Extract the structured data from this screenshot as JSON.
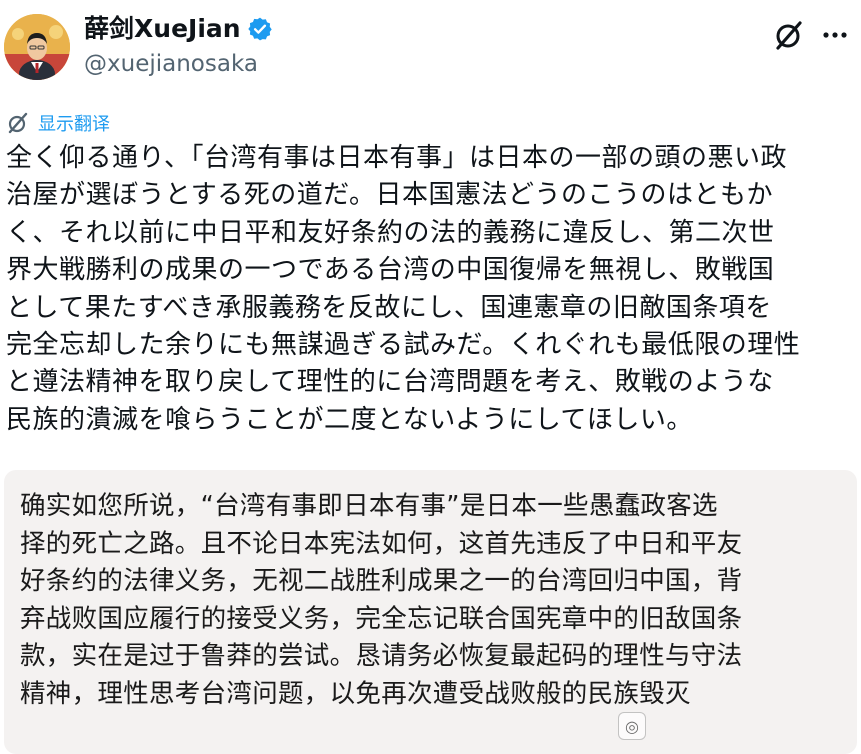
{
  "post": {
    "author": {
      "display_name": "薛剑XueJian",
      "handle": "@xuejianosaka",
      "verified": true,
      "avatar": "avatar-portrait"
    },
    "actions": {
      "grok_icon": "grok-icon",
      "more_icon": "more-icon",
      "more_label": "···"
    },
    "translate_label": "显示翻译",
    "text_lines": [
      "全く仰る通り、「台湾有事は日本有事」は日本の一部の頭の悪い政",
      "治屋が選ぼうとする死の道だ。日本国憲法どうのこうのはともか",
      "く、それ以前に中日平和友好条約の法的義務に違反し、第二次世",
      "界大戦勝利の成果の一つである台湾の中国復帰を無視し、敗戦国",
      "として果たすべき承服義務を反故にし、国連憲章の旧敵国条項を",
      "完全忘却した余りにも無謀過ぎる試みだ。くれぐれも最低限の理性",
      "と遵法精神を取り戻して理性的に台湾問題を考え、敗戦のような",
      "民族的潰滅を喰らうことが二度とないようにしてほしい。"
    ]
  },
  "translation": {
    "lines": [
      "确实如您所说，“台湾有事即日本有事”是日本一些愚蠢政客选",
      "择的死亡之路。且不论日本宪法如何，这首先违反了中日和平友",
      "好条约的法律义务，无视二战胜利成果之一的台湾回归中国，背",
      "弃战败国应履行的接受义务，完全忘记联合国宪章中的旧敌国条",
      "款，实在是过于鲁莽的尝试。恳请务必恢复最起码的理性与守法",
      "精神，理性思考台湾问题，以免再次遭受战败般的民族毁灭"
    ]
  },
  "colors": {
    "link_blue": "#1d9bf0",
    "handle_gray": "#536471",
    "quote_bg": "#f4f2f1"
  }
}
